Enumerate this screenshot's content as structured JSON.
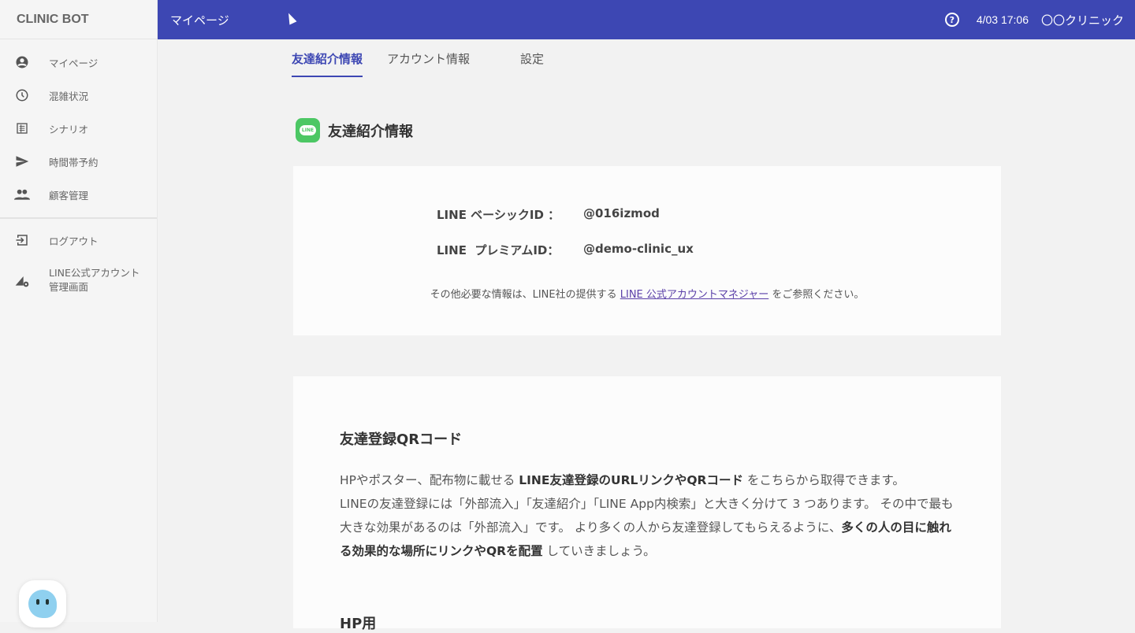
{
  "app": {
    "logo": "CLINIC BOT"
  },
  "header": {
    "title": "マイページ",
    "help_icon": "?",
    "datetime": "4/03 17:06",
    "clinic": "〇〇クリニック"
  },
  "sidebar": {
    "items": [
      {
        "label": "マイページ",
        "icon": "account-circle-icon"
      },
      {
        "label": "混雑状況",
        "icon": "clock-icon"
      },
      {
        "label": "シナリオ",
        "icon": "list-icon"
      },
      {
        "label": "時間帯予約",
        "icon": "send-icon"
      },
      {
        "label": "顧客管理",
        "icon": "people-icon"
      }
    ],
    "bottom": [
      {
        "label": "ログアウト",
        "icon": "logout-icon"
      },
      {
        "label1": "LINE公式アカウント",
        "label2": "管理画面",
        "icon": "admin-settings-icon"
      }
    ]
  },
  "tabs": [
    "友達紹介情報",
    "アカウント情報",
    "設定"
  ],
  "section": {
    "title": "友達紹介情報",
    "line_badge": "LINE"
  },
  "ids": {
    "basic_label": "LINE ベーシックID ：",
    "basic_value": "@016izmod",
    "premium_label": "LINE  プレミアムID：",
    "premium_value": "@demo-clinic_ux"
  },
  "note": {
    "pre": "その他必要な情報は、LINE社の提供する ",
    "link": "LINE 公式アカウントマネジャー",
    "post": " をご参照ください。"
  },
  "qr": {
    "title": "友達登録QRコード",
    "p1": "HPやポスター、配布物に載せる ",
    "b1": "LINE友達登録のURLリンクやQRコード",
    "p2": " をこちらから取得できます。",
    "p3": "LINEの友達登録には「外部流入」「友達紹介」「LINE App内検索」と大きく分けて 3 つあります。 その中で最も大きな効果があるのは「外部流入」です。 より多くの人から友達登録してもらえるように、",
    "b2": "多くの人の目に触れる効果的な場所にリンクやQRを配置",
    "p4": " していきましょう。",
    "sub": "HP用"
  },
  "colors": {
    "primary": "#3d47b3",
    "line_green": "#4cc764"
  }
}
